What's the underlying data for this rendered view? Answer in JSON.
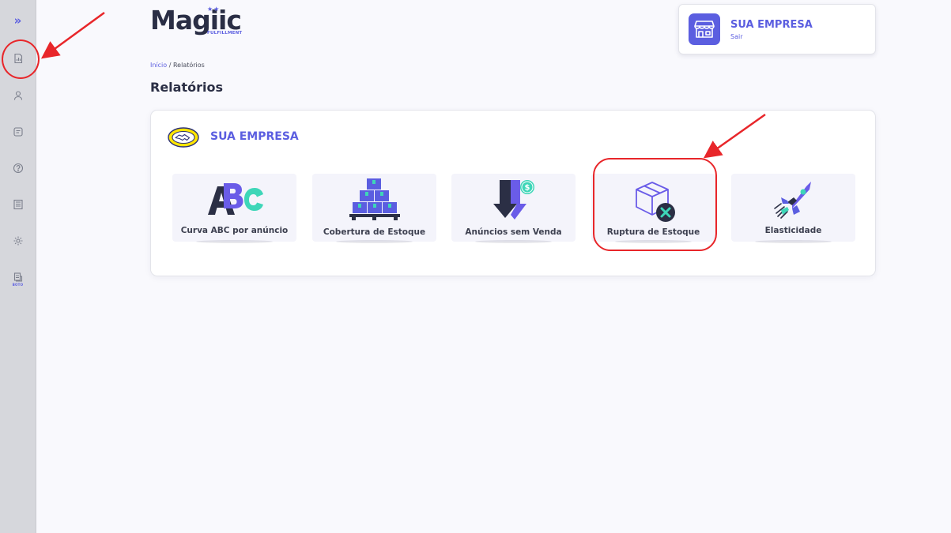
{
  "sidebar": {
    "expand_icon": "»",
    "items": [
      {
        "name": "reports-icon"
      },
      {
        "name": "user-icon"
      },
      {
        "name": "orders-icon"
      },
      {
        "name": "help-icon"
      },
      {
        "name": "invoice-icon"
      },
      {
        "name": "settings-icon"
      },
      {
        "name": "boto-icon"
      }
    ],
    "boto_label": "BOTO"
  },
  "brand": {
    "name": "Magiic",
    "subtitle": "FULFILLMENT",
    "stars": "★★"
  },
  "breadcrumb": {
    "home": "Início",
    "separator": "/",
    "current": "Relatórios"
  },
  "page_title": "Relatórios",
  "company": {
    "name": "SUA EMPRESA",
    "logout": "Sair"
  },
  "panel": {
    "title": "SUA EMPRESA",
    "marketplace_icon": "mercado-livre-logo",
    "reports": [
      {
        "label": "Curva ABC por anúncio",
        "icon": "abc-icon"
      },
      {
        "label": "Cobertura de Estoque",
        "icon": "boxes-pallet-icon"
      },
      {
        "label": "Anúncios sem Venda",
        "icon": "arrow-down-dollar-icon"
      },
      {
        "label": "Ruptura de Estoque",
        "icon": "box-x-icon"
      },
      {
        "label": "Elasticidade",
        "icon": "rocket-icon"
      }
    ]
  },
  "colors": {
    "accent": "#5b5ee0",
    "sidebar_bg": "#d6d7dc",
    "page_bg": "#f9f9fd",
    "annotation": "#e8262a"
  }
}
